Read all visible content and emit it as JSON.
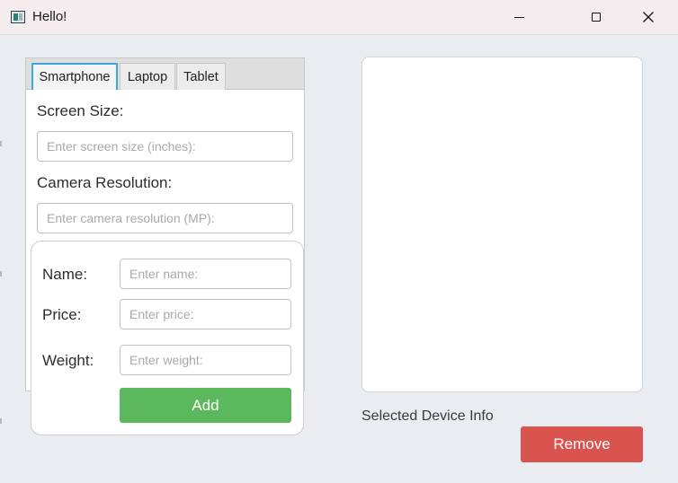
{
  "window": {
    "title": "Hello!"
  },
  "tabs": [
    {
      "label": "Smartphone",
      "active": true
    },
    {
      "label": "Laptop",
      "active": false
    },
    {
      "label": "Tablet",
      "active": false
    }
  ],
  "smartphone": {
    "screen_size_label": "Screen Size:",
    "screen_size_placeholder": "Enter screen size (inches):",
    "camera_label": "Camera Resolution:",
    "camera_placeholder": "Enter camera resolution (MP):"
  },
  "form": {
    "name_label": "Name:",
    "name_placeholder": "Enter name:",
    "price_label": "Price:",
    "price_placeholder": "Enter price:",
    "weight_label": "Weight:",
    "weight_placeholder": "Enter weight:",
    "add_label": "Add"
  },
  "info": {
    "label": "Selected Device Info"
  },
  "actions": {
    "remove_label": "Remove"
  },
  "colors": {
    "add": "#5cb85c",
    "remove": "#d9534f",
    "tab_focus": "#3da5df"
  }
}
